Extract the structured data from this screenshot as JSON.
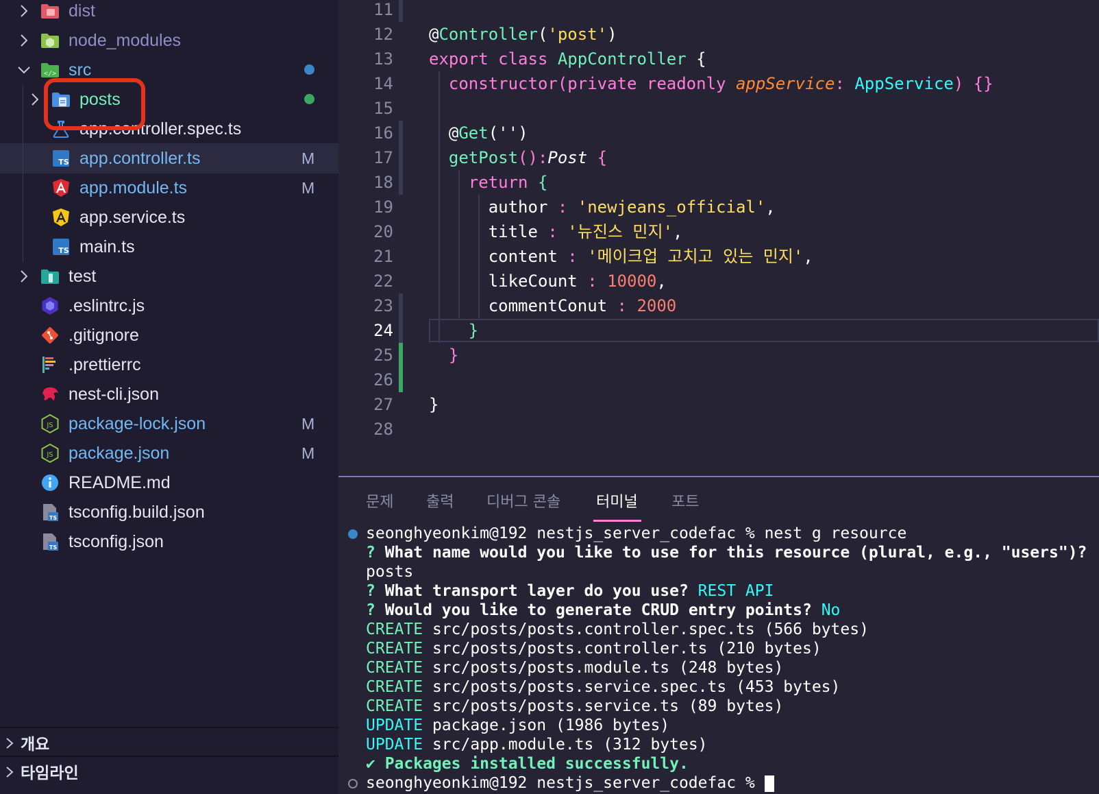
{
  "explorer": {
    "items": [
      {
        "label": "dist",
        "icon": "dist-folder-icon",
        "type": "folder",
        "expanded": false,
        "label_color": "#8f8fc8"
      },
      {
        "label": "node_modules",
        "icon": "node-folder-icon",
        "type": "folder",
        "expanded": false,
        "label_color": "#8f8fc8"
      },
      {
        "label": "src",
        "icon": "src-folder-icon",
        "type": "folder",
        "expanded": true,
        "label_color": "#72b8f1",
        "status_dot": "#3a86c8"
      },
      {
        "label": "posts",
        "icon": "posts-folder-icon",
        "type": "folder",
        "expanded": false,
        "label_color": "#72f1b8",
        "status_dot": "#3aa862"
      },
      {
        "label": "app.controller.spec.ts",
        "icon": "test-file-icon",
        "type": "file",
        "label_color": "#e6e6f0"
      },
      {
        "label": "app.controller.ts",
        "icon": "typescript-file-icon",
        "type": "file",
        "label_color": "#72b8f1",
        "badge": "M",
        "selected": true
      },
      {
        "label": "app.module.ts",
        "icon": "angular-file-icon",
        "type": "file",
        "label_color": "#72b8f1",
        "badge": "M"
      },
      {
        "label": "app.service.ts",
        "icon": "angular-service-icon",
        "type": "file",
        "label_color": "#e6e6f0"
      },
      {
        "label": "main.ts",
        "icon": "typescript-file-icon",
        "type": "file",
        "label_color": "#e6e6f0"
      },
      {
        "label": "test",
        "icon": "test-folder-icon",
        "type": "folder",
        "expanded": false,
        "label_color": "#e6e6f0"
      },
      {
        "label": ".eslintrc.js",
        "icon": "eslint-icon",
        "type": "file",
        "label_color": "#e6e6f0"
      },
      {
        "label": ".gitignore",
        "icon": "git-icon",
        "type": "file",
        "label_color": "#e6e6f0"
      },
      {
        "label": ".prettierrc",
        "icon": "prettier-icon",
        "type": "file",
        "label_color": "#e6e6f0"
      },
      {
        "label": "nest-cli.json",
        "icon": "nest-icon",
        "type": "file",
        "label_color": "#e6e6f0"
      },
      {
        "label": "package-lock.json",
        "icon": "nodejs-icon",
        "type": "file",
        "label_color": "#72b8f1",
        "badge": "M"
      },
      {
        "label": "package.json",
        "icon": "nodejs-icon",
        "type": "file",
        "label_color": "#72b8f1",
        "badge": "M"
      },
      {
        "label": "README.md",
        "icon": "info-icon",
        "type": "file",
        "label_color": "#e6e6f0"
      },
      {
        "label": "tsconfig.build.json",
        "icon": "tsconfig-icon",
        "type": "file",
        "label_color": "#e6e6f0"
      },
      {
        "label": "tsconfig.json",
        "icon": "tsconfig-icon",
        "type": "file",
        "label_color": "#e6e6f0"
      }
    ]
  },
  "bottom_panels": {
    "outline_label": "개요",
    "timeline_label": "타임라인"
  },
  "editor": {
    "active_line": 24,
    "line_numbers": [
      "11",
      "12",
      "13",
      "14",
      "15",
      "16",
      "17",
      "18",
      "19",
      "20",
      "21",
      "22",
      "23",
      "24",
      "25",
      "26",
      "27",
      "28"
    ],
    "lines": [
      [],
      [
        {
          "t": "@",
          "c": "t-dec"
        },
        {
          "t": "Controller",
          "c": "t-fn"
        },
        {
          "t": "(",
          "c": "t-dec"
        },
        {
          "t": "'post'",
          "c": "t-str"
        },
        {
          "t": ")",
          "c": "t-dec"
        }
      ],
      [
        {
          "t": "export class ",
          "c": "t-pink"
        },
        {
          "t": "AppController",
          "c": "t-fn"
        },
        {
          "t": " {",
          "c": "t-dec"
        }
      ],
      [
        {
          "t": "  constructor(private readonly ",
          "c": "t-pink"
        },
        {
          "t": "appService",
          "c": "t-param"
        },
        {
          "t": ": ",
          "c": "t-pink"
        },
        {
          "t": "AppService",
          "c": "t-type"
        },
        {
          "t": ") {}",
          "c": "t-pink"
        }
      ],
      [],
      [
        {
          "t": "  @",
          "c": "t-dec"
        },
        {
          "t": "Get",
          "c": "t-fn"
        },
        {
          "t": "('')",
          "c": "t-dec"
        }
      ],
      [
        {
          "t": "  getPost",
          "c": "t-fn"
        },
        {
          "t": "():",
          "c": "t-pink"
        },
        {
          "t": "Post",
          "c": "t-prop t-it"
        },
        {
          "t": " {",
          "c": "t-pink"
        }
      ],
      [
        {
          "t": "    return ",
          "c": "t-pink"
        },
        {
          "t": "{",
          "c": "t-fn"
        }
      ],
      [
        {
          "t": "      author ",
          "c": "t-prop"
        },
        {
          "t": ": ",
          "c": "t-pink"
        },
        {
          "t": "'newjeans_official'",
          "c": "t-str"
        },
        {
          "t": ",",
          "c": "t-prop"
        }
      ],
      [
        {
          "t": "      title ",
          "c": "t-prop"
        },
        {
          "t": ": ",
          "c": "t-pink"
        },
        {
          "t": "'뉴진스 민지'",
          "c": "t-str"
        },
        {
          "t": ",",
          "c": "t-prop"
        }
      ],
      [
        {
          "t": "      content ",
          "c": "t-prop"
        },
        {
          "t": ": ",
          "c": "t-pink"
        },
        {
          "t": "'메이크업 고치고 있는 민지'",
          "c": "t-str"
        },
        {
          "t": ",",
          "c": "t-prop"
        }
      ],
      [
        {
          "t": "      likeCount ",
          "c": "t-prop"
        },
        {
          "t": ": ",
          "c": "t-pink"
        },
        {
          "t": "10000",
          "c": "t-num"
        },
        {
          "t": ",",
          "c": "t-prop"
        }
      ],
      [
        {
          "t": "      commentConut ",
          "c": "t-prop"
        },
        {
          "t": ": ",
          "c": "t-pink"
        },
        {
          "t": "2000",
          "c": "t-num"
        }
      ],
      [
        {
          "t": "    }",
          "c": "t-fn"
        }
      ],
      [
        {
          "t": "  }",
          "c": "t-pink"
        }
      ],
      [],
      [
        {
          "t": "}",
          "c": "t-dec"
        }
      ],
      []
    ]
  },
  "panel": {
    "tabs": [
      "문제",
      "출력",
      "디버그 콘솔",
      "터미널",
      "포트"
    ],
    "active_tab": "터미널",
    "terminal": {
      "prompt1": "seonghyeonkim@192 nestjs_server_codefac % nest g resource",
      "q1": "What name would you like to use for this resource (plural, e.g., \"users\")?",
      "a1": "posts",
      "q2": "What transport layer do you use?",
      "a2": "REST API",
      "q3": "Would you like to generate CRUD entry points?",
      "a3": "No",
      "creates": [
        "src/posts/posts.controller.spec.ts (566 bytes)",
        "src/posts/posts.controller.ts (210 bytes)",
        "src/posts/posts.module.ts (248 bytes)",
        "src/posts/posts.service.spec.ts (453 bytes)",
        "src/posts/posts.service.ts (89 bytes)"
      ],
      "updates": [
        "package.json (1986 bytes)",
        "src/app.module.ts (312 bytes)"
      ],
      "create_tag": "CREATE",
      "update_tag": "UPDATE",
      "success": "✔ Packages installed successfully.",
      "prompt2": "seonghyeonkim@192 nestjs_server_codefac %"
    }
  },
  "colors": {
    "accent": "#ff7edb",
    "highlight_box": "#e4331d",
    "sidebar_bg": "#1e1c2e",
    "editor_bg": "#262335"
  }
}
